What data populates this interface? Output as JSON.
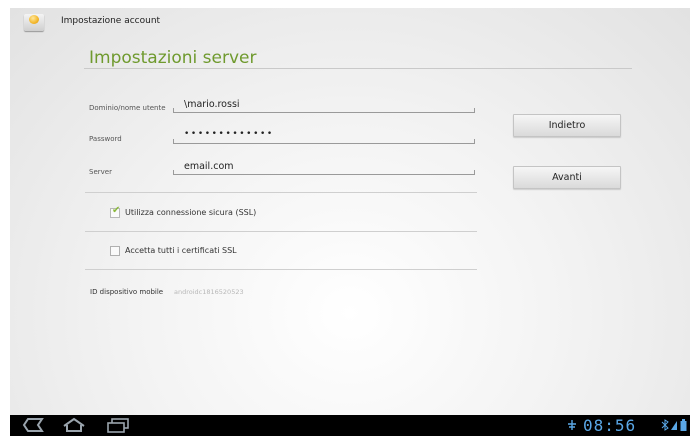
{
  "actionbar": {
    "title": "Impostazione account",
    "icon": "email-app-icon"
  },
  "section": {
    "title": "Impostazioni server"
  },
  "form": {
    "username": {
      "label": "Dominio/nome utente",
      "value": "\\mario.rossi"
    },
    "password": {
      "label": "Password",
      "value": "•••••••••••••"
    },
    "server": {
      "label": "Server",
      "value": "email.com"
    }
  },
  "buttons": {
    "back": "Indietro",
    "next": "Avanti"
  },
  "options": {
    "ssl": {
      "label": "Utilizza connessione sicura (SSL)",
      "checked": true
    },
    "accept_all": {
      "label": "Accetta tutti i certificati SSL",
      "checked": false
    }
  },
  "device": {
    "label": "ID dispositivo mobile",
    "value": "androidc1816520523"
  },
  "systembar": {
    "clock": "08:56",
    "icons": [
      "back-icon",
      "home-icon",
      "recent-apps-icon",
      "usb-debug-icon",
      "bluetooth-icon",
      "signal-icon",
      "battery-icon"
    ],
    "accent": "#5aa7e6"
  },
  "colors": {
    "accent_green": "#6f9a2e",
    "check_green": "#8ab83b"
  }
}
